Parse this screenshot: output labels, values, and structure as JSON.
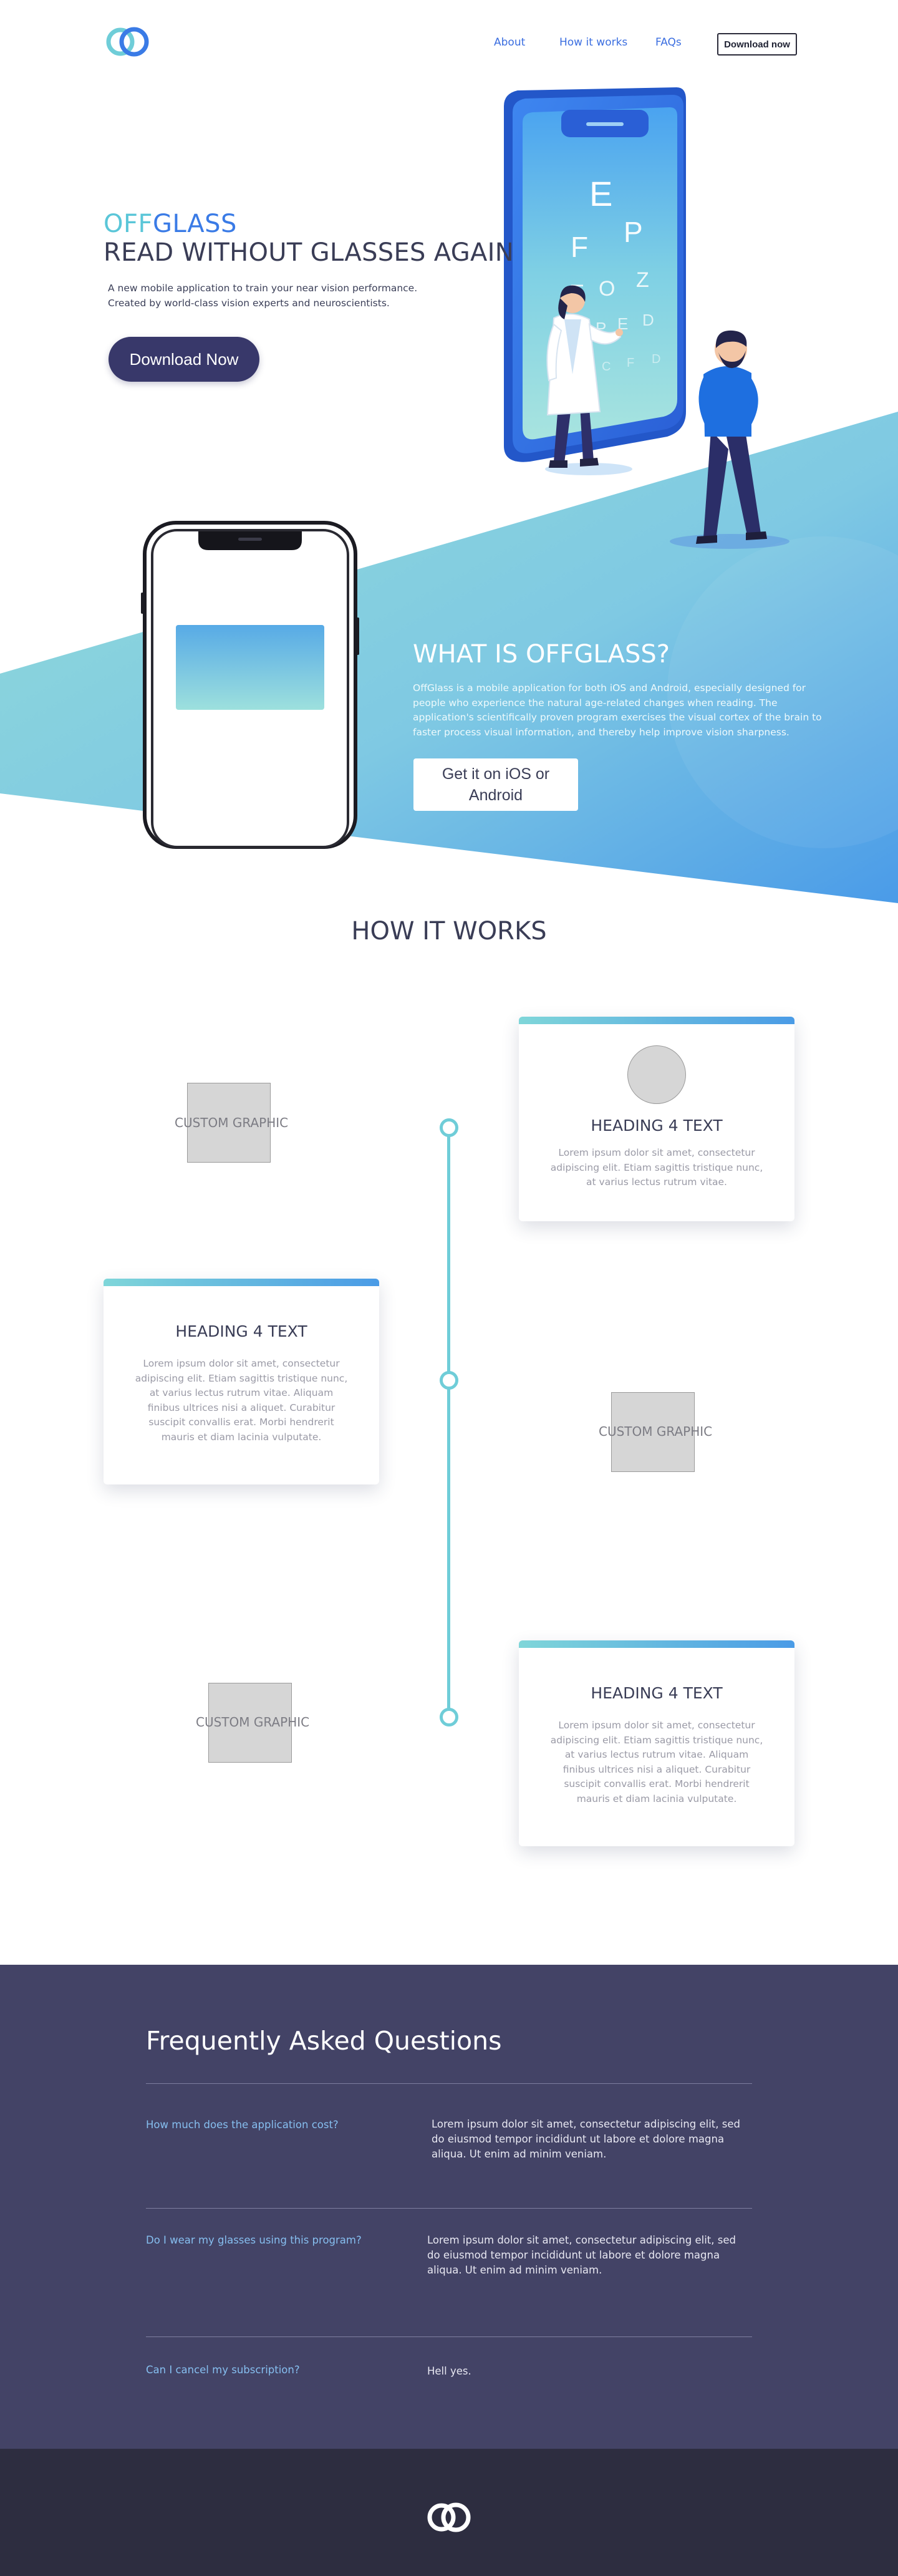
{
  "nav": {
    "logo": "offglass-logo",
    "links": [
      "About",
      "How it works",
      "FAQs"
    ],
    "download_label": "Download now"
  },
  "hero": {
    "brand_part1": "OFF",
    "brand_part2": "GLASS",
    "title": "READ WITHOUT GLASSES AGAIN",
    "desc_line1": "A new mobile application to train your near vision performance.",
    "desc_line2": "Created by world-class vision experts and neuroscientists.",
    "cta": "Download Now",
    "eye_chart": [
      "E",
      "F",
      "P",
      "T",
      "O",
      "Z",
      "L",
      "P",
      "E",
      "D",
      "P",
      "E",
      "C",
      "F",
      "D"
    ]
  },
  "what": {
    "title": "WHAT IS OFFGLASS?",
    "desc": "OffGlass is a mobile application for both iOS and Android, especially designed for people who experience the natural age-related changes when reading. The application's scientifically proven program exercises the visual cortex of the brain to faster process visual information, and thereby help improve vision sharpness.",
    "btn_line1": "Get it on iOS or",
    "btn_line2": "Android"
  },
  "how": {
    "title": "HOW IT WORKS",
    "graphic_label": "CUSTOM GRAPHIC",
    "cards": [
      {
        "heading": "HEADING 4 TEXT",
        "text": "Lorem ipsum dolor sit amet, consectetur adipiscing elit. Etiam sagittis tristique nunc, at varius lectus rutrum vitae."
      },
      {
        "heading": "HEADING 4 TEXT",
        "text": "Lorem ipsum dolor sit amet, consectetur adipiscing elit. Etiam sagittis tristique nunc, at varius lectus rutrum vitae. Aliquam finibus ultrices nisi a aliquet. Curabitur suscipit convallis erat. Morbi hendrerit mauris et diam lacinia vulputate."
      },
      {
        "heading": "HEADING 4 TEXT",
        "text": "Lorem ipsum dolor sit amet, consectetur adipiscing elit. Etiam sagittis tristique nunc, at varius lectus rutrum vitae. Aliquam finibus ultrices nisi a aliquet. Curabitur suscipit convallis erat. Morbi hendrerit mauris et diam lacinia vulputate."
      }
    ]
  },
  "faq": {
    "title": "Frequently Asked Questions",
    "items": [
      {
        "q": "How much does the application cost?",
        "a": "Lorem ipsum dolor sit amet, consectetur adipiscing elit, sed do eiusmod tempor incididunt ut labore et dolore magna aliqua. Ut enim ad minim veniam."
      },
      {
        "q": "Do I wear my glasses using this program?",
        "a": "Lorem ipsum dolor sit amet, consectetur adipiscing elit, sed do eiusmod tempor incididunt ut labore et dolore magna aliqua. Ut enim ad minim veniam."
      },
      {
        "q": "Can I cancel my subscription?",
        "a": "Hell yes."
      }
    ]
  },
  "colors": {
    "brand_teal": "#5ac6d8",
    "brand_blue": "#3a7be6",
    "cta_navy": "#38386a",
    "faq_bg": "#434366",
    "footer_bg": "#2d2d40"
  }
}
